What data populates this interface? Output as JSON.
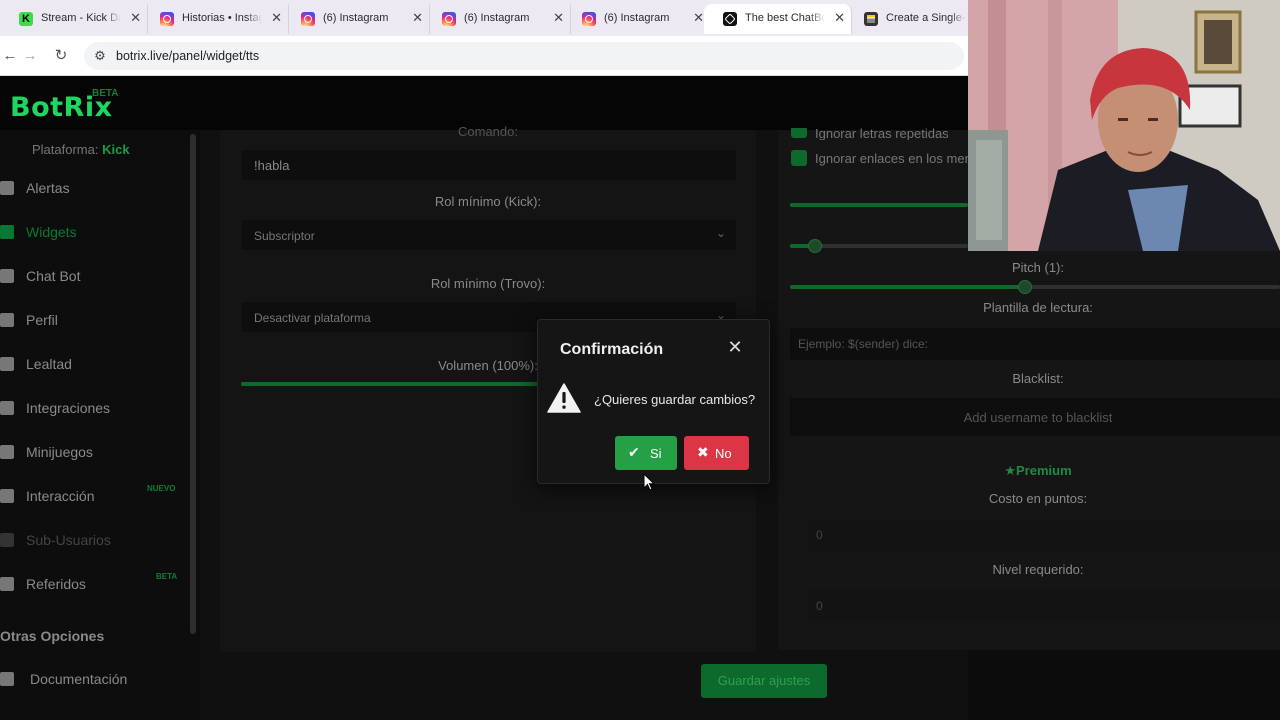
{
  "browser": {
    "tabs": [
      {
        "title": "Stream - Kick Da",
        "favicon": "kick-icon",
        "active": false
      },
      {
        "title": "Historias • Instag",
        "favicon": "instagram-icon",
        "active": false
      },
      {
        "title": "(6) Instagram",
        "favicon": "instagram-icon",
        "active": false
      },
      {
        "title": "(6) Instagram",
        "favicon": "instagram-icon",
        "active": false
      },
      {
        "title": "(6) Instagram",
        "favicon": "instagram-icon",
        "active": false
      },
      {
        "title": "The best ChatBo",
        "favicon": "chatgpt-icon",
        "active": true
      },
      {
        "title": "Create a Single-",
        "favicon": "document-icon",
        "active": false
      }
    ],
    "url": "botrix.live/panel/widget/tts"
  },
  "app": {
    "logo": "BotRix",
    "logo_badge": "BETA",
    "platform_label": "Plataforma:",
    "platform_value": "Kick"
  },
  "sidebar": {
    "items": [
      {
        "label": "Alertas",
        "icon": "bell-icon",
        "state": "normal"
      },
      {
        "label": "Widgets",
        "icon": "grid-icon",
        "state": "active"
      },
      {
        "label": "Chat Bot",
        "icon": "robot-icon",
        "state": "normal"
      },
      {
        "label": "Perfil",
        "icon": "id-card-icon",
        "state": "normal"
      },
      {
        "label": "Lealtad",
        "icon": "trophy-icon",
        "state": "normal"
      },
      {
        "label": "Integraciones",
        "icon": "plug-icon",
        "state": "normal"
      },
      {
        "label": "Minijuegos",
        "icon": "gamepad-icon",
        "state": "normal"
      },
      {
        "label": "Interacción",
        "icon": "music-icon",
        "state": "normal",
        "badge": "NUEVO"
      },
      {
        "label": "Sub-Usuarios",
        "icon": "users-icon",
        "state": "disabled"
      },
      {
        "label": "Referidos",
        "icon": "users-icon",
        "state": "normal",
        "badge": "BETA"
      }
    ],
    "section_title": "Otras Opciones",
    "other_items": [
      {
        "label": "Documentación",
        "icon": "book-icon"
      }
    ]
  },
  "left_panel": {
    "command_label": "Comando:",
    "command_value": "!habla",
    "role_kick_label": "Rol mínimo (Kick):",
    "role_kick_value": "Subscriptor",
    "role_trovo_label": "Rol mínimo (Trovo):",
    "role_trovo_value": "Desactivar plataforma",
    "volume_label": "Volumen (100%):",
    "volume_level": 1.0
  },
  "right_panel": {
    "checkbox_1": "Ignorar letras repetidas",
    "checkbox_2": "Ignorar enlaces en los mensajes",
    "pitch_label": "Pitch (1):",
    "template_label": "Plantilla de lectura:",
    "template_placeholder": "Ejemplo: $(sender) dice:",
    "blacklist_label": "Blacklist:",
    "blacklist_placeholder": "Add username to blacklist",
    "premium_label": "Premium",
    "cost_label": "Costo en puntos:",
    "cost_value": "0",
    "level_label": "Nivel requerido:",
    "level_value": "0"
  },
  "save_button": "Guardar ajustes",
  "modal": {
    "title": "Confirmación",
    "message": "¿Quieres guardar cambios?",
    "yes_label": "Si",
    "no_label": "No"
  },
  "colors": {
    "accent_green": "#1ed760",
    "yes_green": "#25a047",
    "no_red": "#dc3545"
  }
}
